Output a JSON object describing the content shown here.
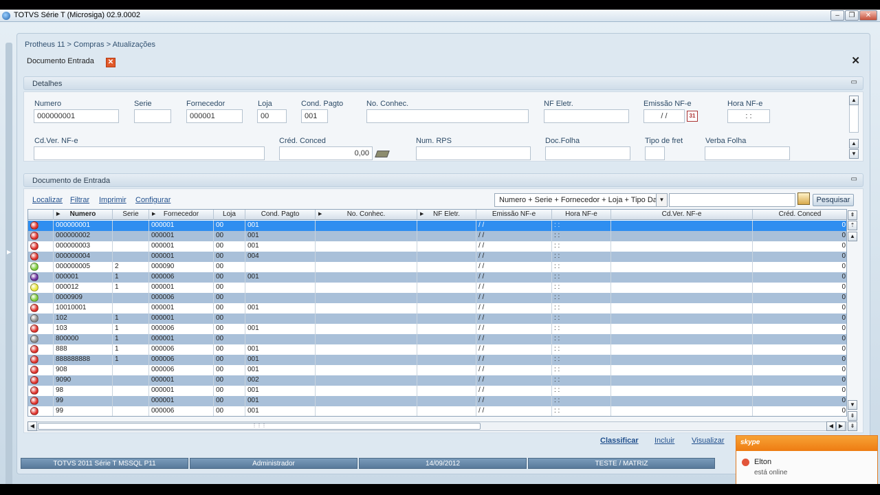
{
  "window": {
    "title": "TOTVS Série T  (Microsiga) 02.9.0002"
  },
  "breadcrumb": "Protheus 11 > Compras  > Atualizações",
  "tab": {
    "label": "Documento Entrada"
  },
  "details": {
    "section_title": "Detalhes",
    "fields": {
      "numero": {
        "label": "Numero",
        "value": "000000001"
      },
      "serie": {
        "label": "Serie",
        "value": ""
      },
      "fornecedor": {
        "label": "Fornecedor",
        "value": "000001"
      },
      "loja": {
        "label": "Loja",
        "value": "00"
      },
      "cond_pagto": {
        "label": "Cond. Pagto",
        "value": "001"
      },
      "no_conhec": {
        "label": "No. Conhec.",
        "value": ""
      },
      "nf_eletr": {
        "label": "NF Eletr.",
        "value": ""
      },
      "emissao_nfe": {
        "label": "Emissão NF-e",
        "value": " / / "
      },
      "hora_nfe": {
        "label": "Hora NF-e",
        "value": " : : "
      },
      "cdver_nfe": {
        "label": "Cd.Ver. NF-e",
        "value": ""
      },
      "cred_conced": {
        "label": "Créd. Conced",
        "value": "0,00"
      },
      "num_rps": {
        "label": "Num. RPS",
        "value": ""
      },
      "doc_folha": {
        "label": "Doc.Folha",
        "value": ""
      },
      "tipo_fret": {
        "label": "Tipo de fret",
        "value": ""
      },
      "verba_folha": {
        "label": "Verba Folha",
        "value": ""
      }
    }
  },
  "browse": {
    "section_title": "Documento de Entrada",
    "toolbar": {
      "localizar": "Localizar",
      "filtrar": "Filtrar",
      "imprimir": "Imprimir",
      "configurar": "Configurar"
    },
    "search": {
      "index_value": "Numero + Serie + Fornecedor + Loja + Tipo Da No",
      "button": "Pesquisar"
    },
    "columns": [
      "",
      "Numero",
      "Serie",
      "Fornecedor",
      "Loja",
      "Cond. Pagto",
      "No. Conhec.",
      "NF Eletr.",
      "Emissão NF-e",
      "Hora NF-e",
      "Cd.Ver. NF-e",
      "Créd. Conced"
    ],
    "rows": [
      {
        "status": "#e0302a",
        "numero": "000000001",
        "serie": "",
        "fornecedor": "000001",
        "loja": "00",
        "cond": "001",
        "emissao": "/ /",
        "hora": ": :",
        "cred": "0"
      },
      {
        "status": "#e0302a",
        "numero": "000000002",
        "serie": "",
        "fornecedor": "000001",
        "loja": "00",
        "cond": "001",
        "emissao": "/ /",
        "hora": ": :",
        "cred": "0"
      },
      {
        "status": "#e0302a",
        "numero": "000000003",
        "serie": "",
        "fornecedor": "000001",
        "loja": "00",
        "cond": "001",
        "emissao": "/ /",
        "hora": ": :",
        "cred": "0"
      },
      {
        "status": "#e0302a",
        "numero": "000000004",
        "serie": "",
        "fornecedor": "000001",
        "loja": "00",
        "cond": "004",
        "emissao": "/ /",
        "hora": ": :",
        "cred": "0"
      },
      {
        "status": "#7ccc3a",
        "numero": "000000005",
        "serie": "2",
        "fornecedor": "000090",
        "loja": "00",
        "cond": "",
        "emissao": "/ /",
        "hora": ": :",
        "cred": "0"
      },
      {
        "status": "#6a2fa0",
        "numero": "000001",
        "serie": "1",
        "fornecedor": "000006",
        "loja": "00",
        "cond": "001",
        "emissao": "/ /",
        "hora": ": :",
        "cred": "0"
      },
      {
        "status": "#e8e83a",
        "numero": "000012",
        "serie": "1",
        "fornecedor": "000001",
        "loja": "00",
        "cond": "",
        "emissao": "/ /",
        "hora": ": :",
        "cred": "0"
      },
      {
        "status": "#7ccc3a",
        "numero": "0000909",
        "serie": "",
        "fornecedor": "000006",
        "loja": "00",
        "cond": "",
        "emissao": "/ /",
        "hora": ": :",
        "cred": "0"
      },
      {
        "status": "#e0302a",
        "numero": "10010001",
        "serie": "",
        "fornecedor": "000001",
        "loja": "00",
        "cond": "001",
        "emissao": "/ /",
        "hora": ": :",
        "cred": "0"
      },
      {
        "status": "#8c8c8c",
        "numero": "102",
        "serie": "1",
        "fornecedor": "000001",
        "loja": "00",
        "cond": "",
        "emissao": "/ /",
        "hora": ": :",
        "cred": "0"
      },
      {
        "status": "#e0302a",
        "numero": "103",
        "serie": "1",
        "fornecedor": "000006",
        "loja": "00",
        "cond": "001",
        "emissao": "/ /",
        "hora": ": :",
        "cred": "0"
      },
      {
        "status": "#8c8c8c",
        "numero": "800000",
        "serie": "1",
        "fornecedor": "000001",
        "loja": "00",
        "cond": "",
        "emissao": "/ /",
        "hora": ": :",
        "cred": "0"
      },
      {
        "status": "#e0302a",
        "numero": "888",
        "serie": "1",
        "fornecedor": "000006",
        "loja": "00",
        "cond": "001",
        "emissao": "/ /",
        "hora": ": :",
        "cred": "0"
      },
      {
        "status": "#e0302a",
        "numero": "888888888",
        "serie": "1",
        "fornecedor": "000006",
        "loja": "00",
        "cond": "001",
        "emissao": "/ /",
        "hora": ": :",
        "cred": "0"
      },
      {
        "status": "#e0302a",
        "numero": "908",
        "serie": "",
        "fornecedor": "000006",
        "loja": "00",
        "cond": "001",
        "emissao": "/ /",
        "hora": ": :",
        "cred": "0"
      },
      {
        "status": "#e0302a",
        "numero": "9090",
        "serie": "",
        "fornecedor": "000001",
        "loja": "00",
        "cond": "002",
        "emissao": "/ /",
        "hora": ": :",
        "cred": "0"
      },
      {
        "status": "#e0302a",
        "numero": "98",
        "serie": "",
        "fornecedor": "000001",
        "loja": "00",
        "cond": "001",
        "emissao": "/ /",
        "hora": ": :",
        "cred": "0"
      },
      {
        "status": "#e0302a",
        "numero": "99",
        "serie": "",
        "fornecedor": "000001",
        "loja": "00",
        "cond": "001",
        "emissao": "/ /",
        "hora": ": :",
        "cred": "0"
      },
      {
        "status": "#e0302a",
        "numero": "99",
        "serie": "",
        "fornecedor": "000006",
        "loja": "00",
        "cond": "001",
        "emissao": "/ /",
        "hora": ": :",
        "cred": "0"
      }
    ]
  },
  "actions": {
    "classificar": "Classificar",
    "incluir": "Incluir",
    "visualizar": "Visualizar"
  },
  "statusbar": {
    "env": "TOTVS 2011 Série T  MSSQL P11",
    "user": "Administrador",
    "date": "14/09/2012",
    "company": "TESTE / MATRIZ"
  },
  "skype": {
    "logo": "skype",
    "contact": "Elton",
    "status": "está online"
  },
  "colors": {
    "selected_row": "#2f8ef0",
    "alt_row": "#a9c0d9",
    "statusbar": "#58799a",
    "skype_orange": "#ee7c12"
  }
}
